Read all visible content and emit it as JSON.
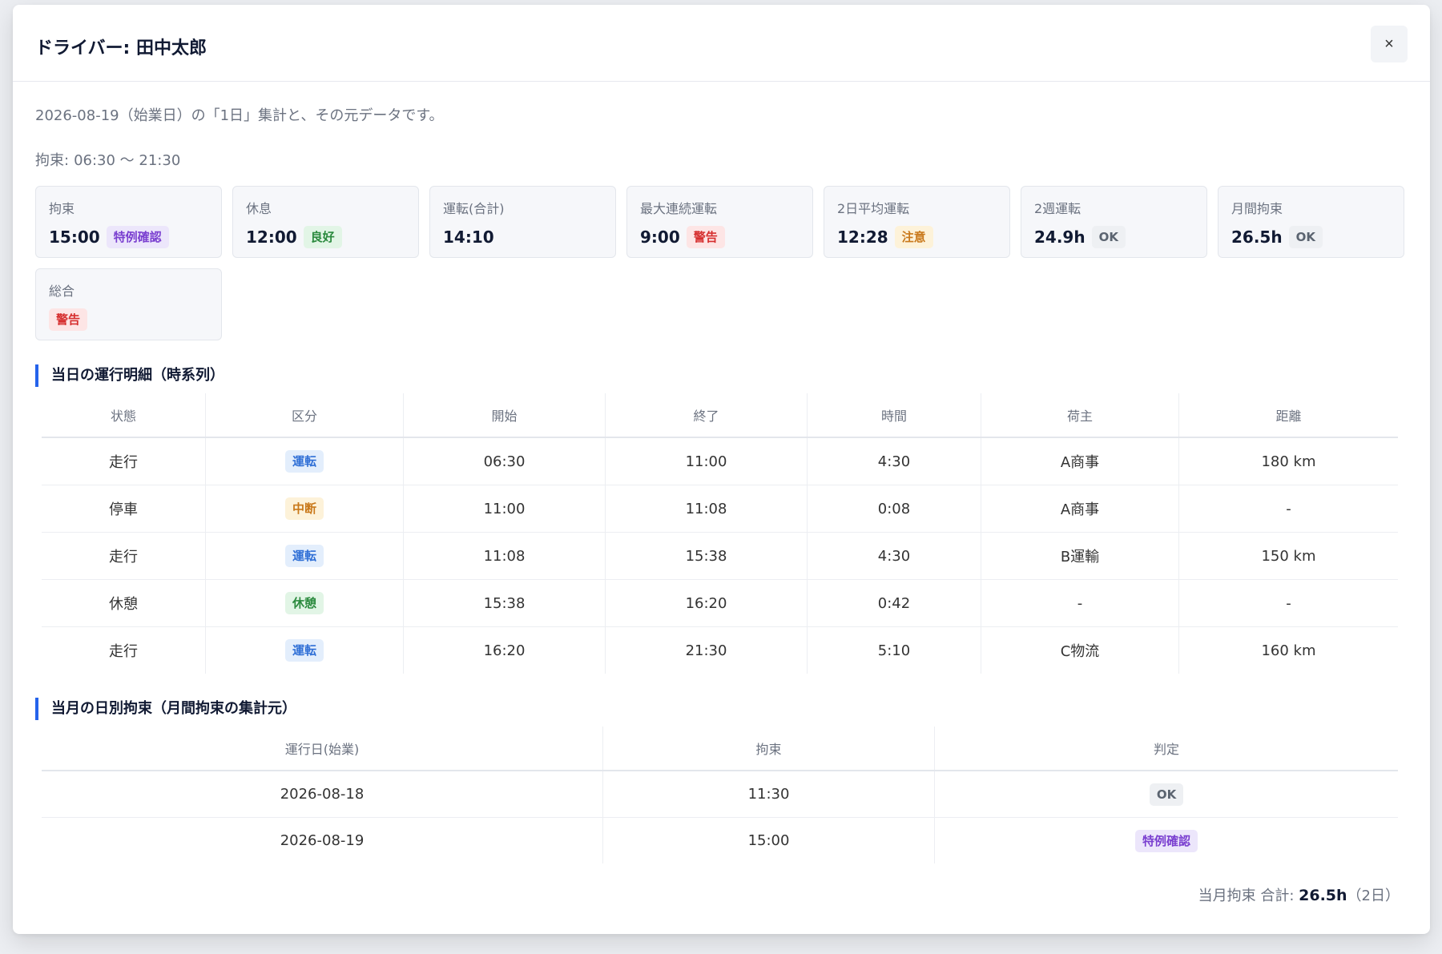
{
  "modal": {
    "title": "ドライバー: 田中太郎",
    "close_label": "×",
    "description": "2026-08-19（始業日）の「1日」集計と、その元データです。",
    "kousoku_label": "拘束:",
    "kousoku_range": "06:30 〜 21:30"
  },
  "metrics": [
    {
      "label": "拘束",
      "value": "15:00",
      "badge": "特例確認",
      "badge_color": "#7a3fd0"
    },
    {
      "label": "休息",
      "value": "12:00",
      "badge": "良好",
      "badge_color": "#2b8a3e"
    },
    {
      "label": "運転(合計)",
      "value": "14:10",
      "badge": "",
      "badge_color": ""
    },
    {
      "label": "最大連続運転",
      "value": "9:00",
      "badge": "警告",
      "badge_color": "#d62f2f"
    },
    {
      "label": "2日平均運転",
      "value": "12:28",
      "badge": "注意",
      "badge_color": "#c9791b"
    },
    {
      "label": "2週運転",
      "value": "24.9h",
      "badge": "OK",
      "badge_color": "#5b6470"
    },
    {
      "label": "月間拘束",
      "value": "26.5h",
      "badge": "OK",
      "badge_color": "#5b6470"
    },
    {
      "label": "総合",
      "value": "",
      "badge": "警告",
      "badge_color": "#d62f2f"
    }
  ],
  "operations": {
    "title": "当日の運行明細（時系列）",
    "headers": [
      "状態",
      "区分",
      "開始",
      "終了",
      "時間",
      "荷主",
      "距離"
    ],
    "rows": [
      {
        "status": "走行",
        "category": "運転",
        "start": "06:30",
        "end": "11:00",
        "duration": "4:30",
        "shipper": "A商事",
        "distance": "180 km"
      },
      {
        "status": "停車",
        "category": "中断",
        "start": "11:00",
        "end": "11:08",
        "duration": "0:08",
        "shipper": "A商事",
        "distance": "-"
      },
      {
        "status": "走行",
        "category": "運転",
        "start": "11:08",
        "end": "15:38",
        "duration": "4:30",
        "shipper": "B運輸",
        "distance": "150 km"
      },
      {
        "status": "休憩",
        "category": "休憩",
        "start": "15:38",
        "end": "16:20",
        "duration": "0:42",
        "shipper": "-",
        "distance": "-"
      },
      {
        "status": "走行",
        "category": "運転",
        "start": "16:20",
        "end": "21:30",
        "duration": "5:10",
        "shipper": "C物流",
        "distance": "160 km"
      }
    ]
  },
  "monthly": {
    "title": "当月の日別拘束（月間拘束の集計元）",
    "headers": [
      "運行日(始業)",
      "拘束",
      "判定"
    ],
    "rows": [
      {
        "date": "2026-08-18",
        "kousoku": "11:30",
        "judgement": "OK"
      },
      {
        "date": "2026-08-19",
        "kousoku": "15:00",
        "judgement": "特例確認"
      }
    ],
    "sum_label": "当月拘束 合計:",
    "sum_value": "26.5h",
    "sum_days": "（2日）"
  }
}
